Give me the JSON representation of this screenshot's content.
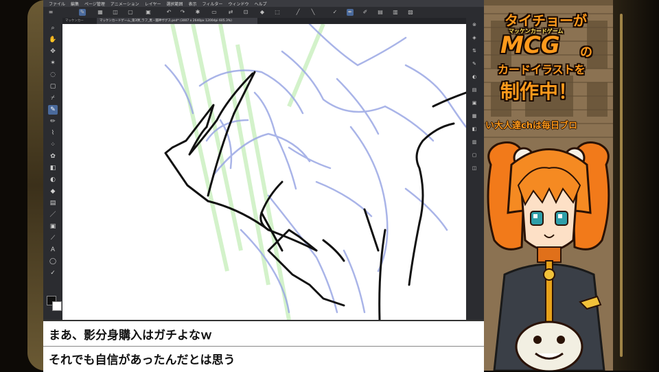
{
  "menu": [
    "ファイル",
    "編集",
    "ページ管理",
    "アニメーション",
    "レイヤー",
    "選択範囲",
    "表示",
    "フィルター",
    "ウィンドウ",
    "ヘルプ"
  ],
  "doc_tabs": [
    {
      "label": "マッケンカー",
      "active": false
    },
    {
      "label": "マッケンカードゲーム_第3弾_ラフ_黒・闇神ザグス.psd* (3007 x 2640px 1200dpi 605.3%)",
      "active": true
    }
  ],
  "tools": [
    "zoom",
    "hand",
    "move",
    "wand",
    "lasso",
    "select",
    "eyedrop",
    "pen",
    "pencil",
    "brush",
    "airbrush",
    "deco",
    "eraser",
    "blend",
    "fill",
    "gradient",
    "figure",
    "frame",
    "ruler",
    "text",
    "balloon",
    "correct"
  ],
  "subtitles": {
    "line1": "まあ、影分身購入はガチよなｗ",
    "line2": "それでも自信があったんだとは思う"
  },
  "stream": {
    "logo_line1": "タイチョーが",
    "logo_small": "マッケンカードゲーム",
    "logo_mcg": "MCG",
    "logo_no": "の",
    "logo_line3": "カードイラストを",
    "logo_line4": "制作中！",
    "ticker": "い大人達chは毎日ブロ"
  },
  "colors": {
    "accent": "#4a6a9c",
    "logo_orange": "#ff9a1c",
    "sketch_blue": "#9aa6e0",
    "sketch_green": "#bfe8b0"
  }
}
